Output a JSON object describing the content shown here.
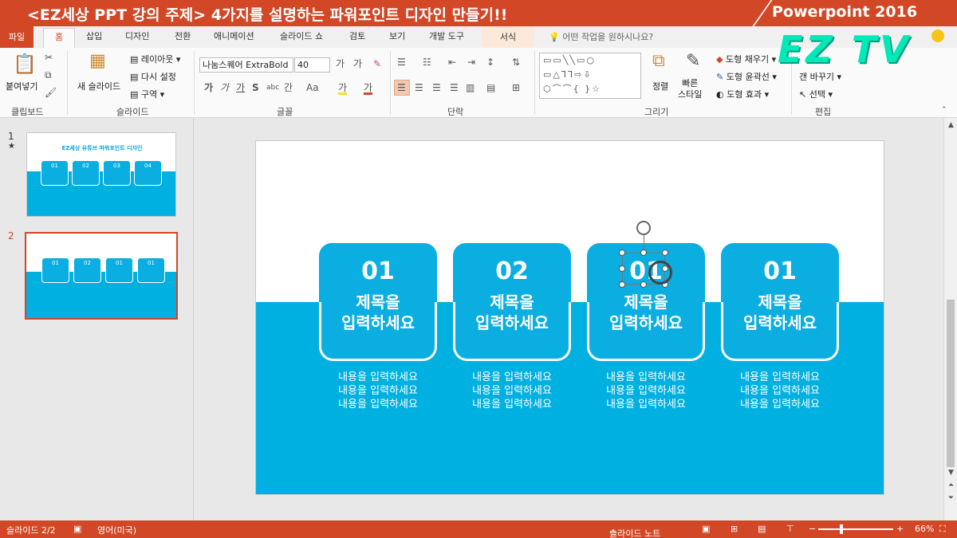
{
  "banner": {
    "title": "<EZ세상 PPT 강의 주제> 4가지를 설명하는 파워포인트 디자인 만들기!!",
    "product": "Powerpoint 2016"
  },
  "watermark": "EZ TV",
  "tabs": {
    "file": "파일",
    "home": "홈",
    "items": [
      "삽입",
      "디자인",
      "전환",
      "애니메이션",
      "슬라이드 쇼",
      "검토",
      "보기",
      "개발 도구"
    ],
    "format": "서식",
    "tell_me": "어떤 작업을 원하시나요?"
  },
  "ribbon": {
    "clipboard": {
      "paste": "붙여넣기",
      "label": "클립보드"
    },
    "slides": {
      "new_slide": "새 슬라이드",
      "layout": "레이아웃",
      "reset": "다시 설정",
      "section": "구역",
      "label": "슬라이드"
    },
    "font": {
      "font_name": "나눔스퀘어 ExtraBold",
      "font_size": "40",
      "label": "글꼴"
    },
    "paragraph": {
      "label": "단락"
    },
    "drawing": {
      "arrange": "정렬",
      "quick_styles": "빠른\n스타일",
      "fill": "도형 채우기",
      "outline": "도형 윤곽선",
      "effects": "도형 효과",
      "label": "그리기"
    },
    "editing": {
      "replace": "바꾸기",
      "select": "선택",
      "label": "편집"
    }
  },
  "thumbnails": [
    {
      "num": "1",
      "star": "★",
      "header": "EZ세상 유튜브 파워포인트 디자인",
      "cards": [
        "01",
        "02",
        "03",
        "04"
      ]
    },
    {
      "num": "2",
      "cards": [
        "01",
        "02",
        "01",
        "01"
      ]
    }
  ],
  "slide": {
    "cards": [
      {
        "num": "01",
        "title1": "제목을",
        "title2": "입력하세요"
      },
      {
        "num": "02",
        "title1": "제목을",
        "title2": "입력하세요"
      },
      {
        "num": "01",
        "title1": "제목을",
        "title2": "입력하세요"
      },
      {
        "num": "01",
        "title1": "제목을",
        "title2": "입력하세요"
      }
    ],
    "content_line": "내용을 입력하세요"
  },
  "status": {
    "slide": "슬라이드 2/2",
    "language": "영어(미국)",
    "notes": "슬라이드 노트",
    "zoom": "66%"
  },
  "colors": {
    "accent": "#d24726",
    "slide_blue": "#00b0e0",
    "watermark": "#00e9b8"
  }
}
